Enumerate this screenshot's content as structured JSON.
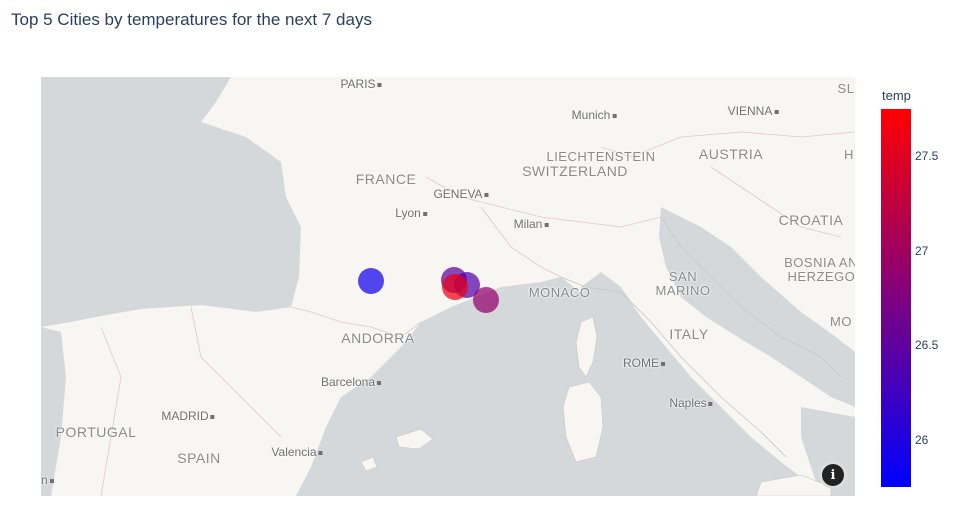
{
  "title": "Top 5 Cities by temperatures for the next 7 days",
  "map": {
    "city_labels": [
      "PARIS",
      "Munich",
      "VIENNA",
      "GENEVA",
      "Lyon",
      "Milan",
      "Barcelona",
      "MADRID",
      "Valencia",
      "ROME",
      "Naples",
      "isbon"
    ],
    "country_labels": [
      "FRANCE",
      "LIECHTENSTEIN",
      "AUSTRIA",
      "SWITZERLAND",
      "CROATIA",
      "BOSNIA AND HERZEGOV",
      "SAN MARINO",
      "MONACO",
      "ITALY",
      "ANDORRA",
      "PORTUGAL",
      "SPAIN",
      "SL",
      "H",
      "MO"
    ],
    "info_icon": "info-icon"
  },
  "chart_data": {
    "type": "scatter",
    "kind": "scatter_mapbox",
    "color_field": "temp",
    "points": [
      {
        "temp": 25.9
      },
      {
        "temp": 26.5
      },
      {
        "temp": 26.4
      },
      {
        "temp": 27.6
      },
      {
        "temp": 26.9
      }
    ],
    "colorscale": [
      "#0000ff",
      "#ff0000"
    ],
    "color_range": [
      25.75,
      27.75
    ],
    "colorbar": {
      "title": "temp",
      "ticks": [
        "26",
        "26.5",
        "27",
        "27.5"
      ]
    }
  }
}
